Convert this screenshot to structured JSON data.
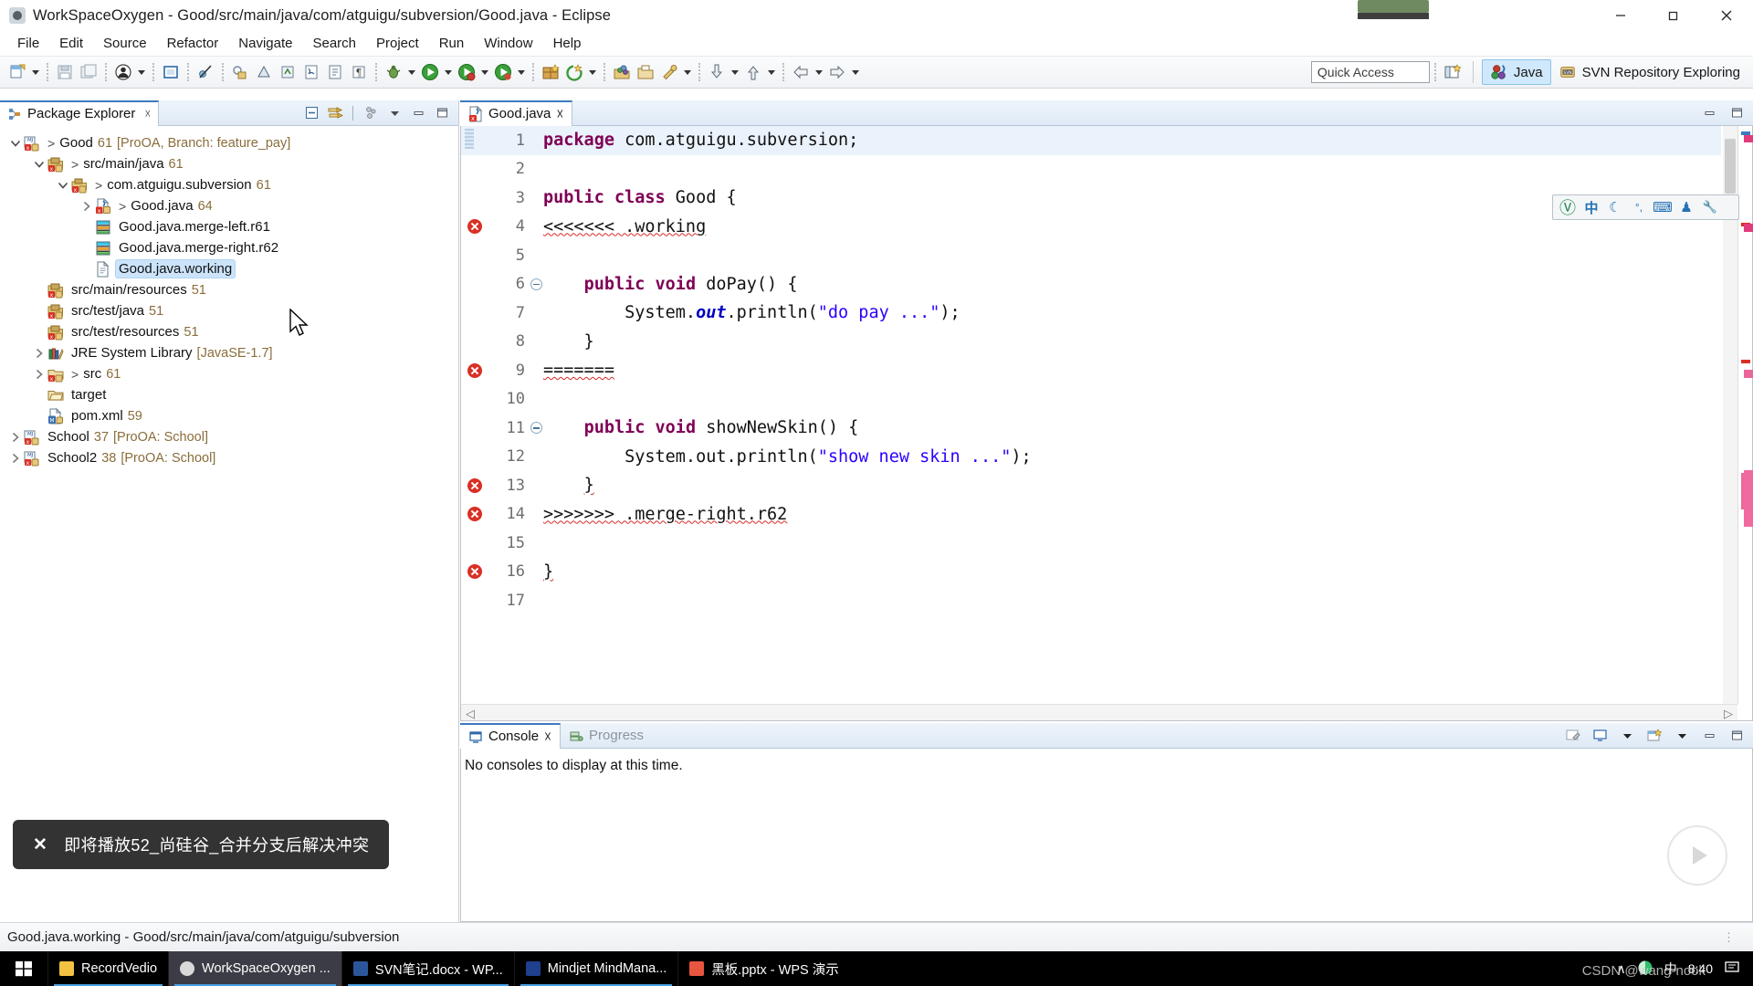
{
  "window": {
    "title": "WorkSpaceOxygen - Good/src/main/java/com/atguigu/subversion/Good.java - Eclipse",
    "minimize_label": "Minimize",
    "maximize_label": "Restore",
    "close_label": "Close"
  },
  "menubar": {
    "items": [
      "File",
      "Edit",
      "Source",
      "Refactor",
      "Navigate",
      "Search",
      "Project",
      "Run",
      "Window",
      "Help"
    ]
  },
  "toolbar": {
    "quick_access_placeholder": "Quick Access",
    "buttons": [
      {
        "name": "new-wizard",
        "icon": "new-file-icon"
      },
      {
        "name": "save",
        "icon": "save-icon"
      },
      {
        "name": "save-all",
        "icon": "save-all-icon"
      },
      {
        "name": "person",
        "icon": "person-icon"
      },
      {
        "name": "toggle-mark-occurrences",
        "icon": "mark-occurrences-icon"
      },
      {
        "name": "skip-breakpoints",
        "icon": "skip-breakpoints-icon"
      },
      {
        "name": "new-java-package",
        "icon": "package-icon"
      },
      {
        "name": "new-java-class",
        "icon": "class-icon"
      },
      {
        "name": "new-java-interface",
        "icon": "interface-icon"
      },
      {
        "name": "new-scrapbook",
        "icon": "scrapbook-icon"
      },
      {
        "name": "open-task",
        "icon": "task-icon"
      },
      {
        "name": "debug",
        "icon": "debug-icon"
      },
      {
        "name": "run",
        "icon": "run-icon"
      },
      {
        "name": "run-coverage",
        "icon": "coverage-icon"
      },
      {
        "name": "external-tools",
        "icon": "external-tools-icon"
      },
      {
        "name": "new-annotation",
        "icon": "annotation-icon"
      },
      {
        "name": "new-package-2",
        "icon": "package2-icon"
      },
      {
        "name": "open-type",
        "icon": "open-type-icon"
      },
      {
        "name": "search",
        "icon": "search-icon"
      },
      {
        "name": "next-annotation",
        "icon": "next-annotation-icon"
      },
      {
        "name": "previous-annotation",
        "icon": "previous-annotation-icon"
      },
      {
        "name": "back",
        "icon": "back-arrow-icon"
      },
      {
        "name": "forward",
        "icon": "forward-arrow-icon"
      }
    ]
  },
  "perspectives": {
    "open_perspective_label": "Open Perspective",
    "items": [
      {
        "label": "Java",
        "active": true
      },
      {
        "label": "SVN Repository Exploring",
        "active": false
      }
    ]
  },
  "package_explorer": {
    "tab_label": "Package Explorer",
    "tools": [
      "collapse-all-icon",
      "link-with-editor-icon",
      "view-menu-icon",
      "minimize-icon",
      "maximize-icon"
    ],
    "tree": [
      {
        "indent": 0,
        "twist": "down",
        "icon": "java-project-svn-icon",
        "marker": ">",
        "label": "Good",
        "rev": "61",
        "extra": "[ProOA, Branch: feature_pay]",
        "selected": false
      },
      {
        "indent": 1,
        "twist": "down",
        "icon": "source-folder-svn-icon",
        "marker": ">",
        "label": "src/main/java",
        "rev": "61",
        "extra": "",
        "selected": false
      },
      {
        "indent": 2,
        "twist": "down",
        "icon": "package-svn-icon",
        "marker": ">",
        "label": "com.atguigu.subversion",
        "rev": "61",
        "extra": "",
        "selected": false
      },
      {
        "indent": 3,
        "twist": "right",
        "icon": "java-file-error-icon",
        "marker": ">",
        "label": "Good.java",
        "rev": "64",
        "extra": "",
        "selected": false
      },
      {
        "indent": 3,
        "twist": "none",
        "icon": "merge-file-icon",
        "marker": "",
        "label": "Good.java.merge-left.r61",
        "rev": "",
        "extra": "",
        "selected": false
      },
      {
        "indent": 3,
        "twist": "none",
        "icon": "merge-file-icon",
        "marker": "",
        "label": "Good.java.merge-right.r62",
        "rev": "",
        "extra": "",
        "selected": false
      },
      {
        "indent": 3,
        "twist": "none",
        "icon": "text-file-icon",
        "marker": "",
        "label": "Good.java.working",
        "rev": "",
        "extra": "",
        "selected": true
      },
      {
        "indent": 1,
        "twist": "none",
        "icon": "source-folder-svn-icon",
        "marker": "",
        "label": "src/main/resources",
        "rev": "51",
        "extra": "",
        "selected": false
      },
      {
        "indent": 1,
        "twist": "none",
        "icon": "source-folder-svn-icon",
        "marker": "",
        "label": "src/test/java",
        "rev": "51",
        "extra": "",
        "selected": false
      },
      {
        "indent": 1,
        "twist": "none",
        "icon": "source-folder-svn-icon",
        "marker": "",
        "label": "src/test/resources",
        "rev": "51",
        "extra": "",
        "selected": false
      },
      {
        "indent": 1,
        "twist": "right",
        "icon": "jre-library-icon",
        "marker": "",
        "label": "JRE System Library",
        "rev": "",
        "extra": "[JavaSE-1.7]",
        "selected": false
      },
      {
        "indent": 1,
        "twist": "right",
        "icon": "folder-svn-icon",
        "marker": ">",
        "label": "src",
        "rev": "61",
        "extra": "",
        "selected": false
      },
      {
        "indent": 1,
        "twist": "none",
        "icon": "folder-icon",
        "marker": "",
        "label": "target",
        "rev": "",
        "extra": "",
        "selected": false
      },
      {
        "indent": 1,
        "twist": "none",
        "icon": "pom-xml-icon",
        "marker": "",
        "label": "pom.xml",
        "rev": "59",
        "extra": "",
        "selected": false
      },
      {
        "indent": 0,
        "twist": "right",
        "icon": "java-project-svn-icon",
        "marker": "",
        "label": "School",
        "rev": "37",
        "extra": "[ProOA: School]",
        "selected": false
      },
      {
        "indent": 0,
        "twist": "right",
        "icon": "java-project-svn-icon",
        "marker": "",
        "label": "School2",
        "rev": "38",
        "extra": "[ProOA: School]",
        "selected": false
      }
    ]
  },
  "editor": {
    "tab_label": "Good.java",
    "tab_icon": "java-file-error-icon",
    "current_line": 1,
    "lines": [
      {
        "n": 1,
        "error": false,
        "fold": false,
        "cur": true,
        "tokens": [
          {
            "t": "package ",
            "c": "kw"
          },
          {
            "t": "com.atguigu.subversion;",
            "c": ""
          }
        ]
      },
      {
        "n": 2,
        "error": false,
        "fold": false,
        "cur": false,
        "tokens": []
      },
      {
        "n": 3,
        "error": false,
        "fold": false,
        "cur": false,
        "tokens": [
          {
            "t": "public class ",
            "c": "kw"
          },
          {
            "t": "Good {",
            "c": ""
          }
        ]
      },
      {
        "n": 4,
        "error": true,
        "fold": false,
        "cur": false,
        "tokens": [
          {
            "t": "<<<<<<< .working",
            "c": "err-squig"
          }
        ]
      },
      {
        "n": 5,
        "error": false,
        "fold": false,
        "cur": false,
        "tokens": []
      },
      {
        "n": 6,
        "error": false,
        "fold": true,
        "cur": false,
        "tokens": [
          {
            "t": "    ",
            "c": ""
          },
          {
            "t": "public void ",
            "c": "kw"
          },
          {
            "t": "doPay() {",
            "c": ""
          }
        ]
      },
      {
        "n": 7,
        "error": false,
        "fold": false,
        "cur": false,
        "tokens": [
          {
            "t": "        System.",
            "c": ""
          },
          {
            "t": "out",
            "c": "fld"
          },
          {
            "t": ".println(",
            "c": ""
          },
          {
            "t": "\"do pay ...\"",
            "c": "str"
          },
          {
            "t": ");",
            "c": ""
          }
        ]
      },
      {
        "n": 8,
        "error": false,
        "fold": false,
        "cur": false,
        "tokens": [
          {
            "t": "    }",
            "c": ""
          }
        ]
      },
      {
        "n": 9,
        "error": true,
        "fold": false,
        "cur": false,
        "tokens": [
          {
            "t": "=======",
            "c": "err-squig"
          }
        ]
      },
      {
        "n": 10,
        "error": false,
        "fold": false,
        "cur": false,
        "tokens": []
      },
      {
        "n": 11,
        "error": false,
        "fold": true,
        "cur": false,
        "tokens": [
          {
            "t": "    ",
            "c": ""
          },
          {
            "t": "public void ",
            "c": "kw"
          },
          {
            "t": "showNewSkin() {",
            "c": ""
          }
        ]
      },
      {
        "n": 12,
        "error": false,
        "fold": false,
        "cur": false,
        "tokens": [
          {
            "t": "        System.out.println(",
            "c": ""
          },
          {
            "t": "\"show new skin ...\"",
            "c": "str"
          },
          {
            "t": ");",
            "c": ""
          }
        ]
      },
      {
        "n": 13,
        "error": true,
        "fold": false,
        "cur": false,
        "tokens": [
          {
            "t": "    ",
            "c": ""
          },
          {
            "t": "}",
            "c": "err-squig"
          }
        ]
      },
      {
        "n": 14,
        "error": true,
        "fold": false,
        "cur": false,
        "tokens": [
          {
            "t": ">>>>>>> .merge-right.r62",
            "c": "err-squig"
          }
        ]
      },
      {
        "n": 15,
        "error": false,
        "fold": false,
        "cur": false,
        "tokens": []
      },
      {
        "n": 16,
        "error": true,
        "fold": false,
        "cur": false,
        "tokens": [
          {
            "t": "}",
            "c": "err-squig"
          }
        ]
      },
      {
        "n": 17,
        "error": false,
        "fold": false,
        "cur": false,
        "tokens": []
      }
    ]
  },
  "console": {
    "tabs": [
      {
        "label": "Console",
        "active": true,
        "icon": "console-icon"
      },
      {
        "label": "Progress",
        "active": false,
        "icon": "progress-icon"
      }
    ],
    "message": "No consoles to display at this time.",
    "tools": [
      "open-console-icon",
      "display-selected-console-icon",
      "dropdown-icon",
      "new-console-view-icon",
      "dropdown-icon",
      "minimize-icon",
      "maximize-icon"
    ]
  },
  "statusbar": {
    "text": "Good.java.working - Good/src/main/java/com/atguigu/subversion"
  },
  "toast": {
    "close_label": "✕",
    "message": "即将播放52_尚硅谷_合并分支后解决冲突"
  },
  "ime_toolbar": {
    "items": [
      {
        "name": "sogou-logo-icon",
        "glyph": "ⓤ"
      },
      {
        "name": "chinese-mode-icon",
        "glyph": "中"
      },
      {
        "name": "moon-icon",
        "glyph": "☾"
      },
      {
        "name": "punctuation-icon",
        "glyph": "。,"
      },
      {
        "name": "soft-keyboard-icon",
        "glyph": "⌨"
      },
      {
        "name": "user-icon",
        "glyph": "♟"
      },
      {
        "name": "settings-wrench-icon",
        "glyph": "🔧"
      }
    ]
  },
  "taskbar": {
    "start_label": "Start",
    "items": [
      {
        "label": "RecordVedio",
        "icon_color": "#f2c242",
        "active": false
      },
      {
        "label": "WorkSpaceOxygen ...",
        "icon_color": "#d9d9d9",
        "active": true
      },
      {
        "label": "SVN笔记.docx - WP...",
        "icon_color": "#2b579a",
        "active": false
      },
      {
        "label": "Mindjet MindMana...",
        "icon_color": "#1f3f8f",
        "active": false
      },
      {
        "label": "黑板.pptx - WPS 演示",
        "icon_color": "#e8563f",
        "active": false
      }
    ],
    "tray": {
      "show_hidden_icons": "∧",
      "net_icon": "network-icon",
      "ime_label": "中",
      "time": "8:40",
      "notification_icon": "notification-icon"
    }
  },
  "watermark": {
    "text": "CSDN @wang-nook"
  }
}
